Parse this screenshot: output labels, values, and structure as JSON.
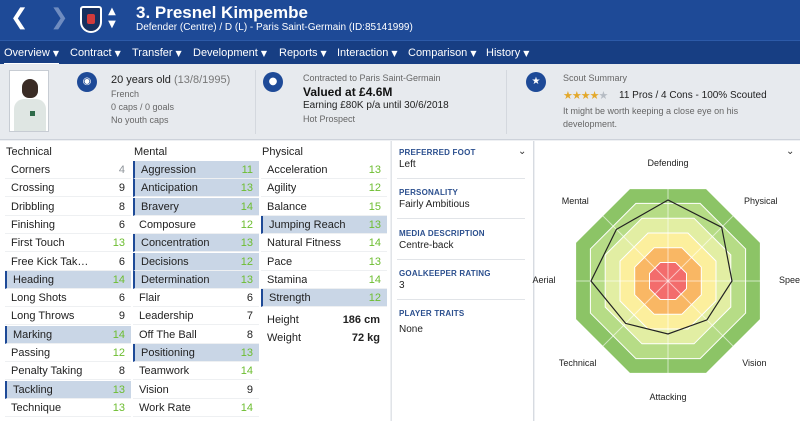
{
  "header": {
    "name": "3. Presnel Kimpembe",
    "subtitle": "Defender (Centre) / D (L) - Paris Saint-Germain (ID:85141999)"
  },
  "menu": [
    "Overview",
    "Contract",
    "Transfer",
    "Development",
    "Reports",
    "Interaction",
    "Comparison",
    "History"
  ],
  "personal": {
    "age": "20 years old",
    "dob": "(13/8/1995)",
    "nationality": "French",
    "caps": "0 caps / 0 goals",
    "youth_caps": "No youth caps"
  },
  "contract": {
    "club_line": "Contracted to Paris Saint-Germain",
    "value": "Valued at £4.6M",
    "earning": "Earning £80K p/a until 30/6/2018",
    "status": "Hot Prospect"
  },
  "scout": {
    "title": "Scout Summary",
    "rating_stars": 3.5,
    "stars_max": 5,
    "summary": "11 Pros / 4 Cons - 100% Scouted",
    "note_line1": "It might be worth keeping a close eye on his",
    "note_line2": "development."
  },
  "technical": {
    "title": "Technical",
    "rows": [
      {
        "label": "Corners",
        "value": "4"
      },
      {
        "label": "Crossing",
        "value": "9"
      },
      {
        "label": "Dribbling",
        "value": "8"
      },
      {
        "label": "Finishing",
        "value": "6"
      },
      {
        "label": "First Touch",
        "value": "13"
      },
      {
        "label": "Free Kick Tak…",
        "value": "6"
      },
      {
        "label": "Heading",
        "value": "14"
      },
      {
        "label": "Long Shots",
        "value": "6"
      },
      {
        "label": "Long Throws",
        "value": "9"
      },
      {
        "label": "Marking",
        "value": "14"
      },
      {
        "label": "Passing",
        "value": "12"
      },
      {
        "label": "Penalty Taking",
        "value": "8"
      },
      {
        "label": "Tackling",
        "value": "13"
      },
      {
        "label": "Technique",
        "value": "13"
      }
    ]
  },
  "mental": {
    "title": "Mental",
    "rows": [
      {
        "label": "Aggression",
        "value": "11"
      },
      {
        "label": "Anticipation",
        "value": "13"
      },
      {
        "label": "Bravery",
        "value": "14"
      },
      {
        "label": "Composure",
        "value": "12"
      },
      {
        "label": "Concentration",
        "value": "13"
      },
      {
        "label": "Decisions",
        "value": "12"
      },
      {
        "label": "Determination",
        "value": "13"
      },
      {
        "label": "Flair",
        "value": "6"
      },
      {
        "label": "Leadership",
        "value": "7"
      },
      {
        "label": "Off The Ball",
        "value": "8"
      },
      {
        "label": "Positioning",
        "value": "13"
      },
      {
        "label": "Teamwork",
        "value": "14"
      },
      {
        "label": "Vision",
        "value": "9"
      },
      {
        "label": "Work Rate",
        "value": "14"
      }
    ]
  },
  "physical": {
    "title": "Physical",
    "rows": [
      {
        "label": "Acceleration",
        "value": "13"
      },
      {
        "label": "Agility",
        "value": "12"
      },
      {
        "label": "Balance",
        "value": "15"
      },
      {
        "label": "Jumping Reach",
        "value": "13"
      },
      {
        "label": "Natural Fitness",
        "value": "14"
      },
      {
        "label": "Pace",
        "value": "13"
      },
      {
        "label": "Stamina",
        "value": "14"
      },
      {
        "label": "Strength",
        "value": "12"
      }
    ],
    "height_label": "Height",
    "height_value": "186 cm",
    "weight_label": "Weight",
    "weight_value": "72 kg"
  },
  "details": {
    "preferred_foot_label": "PREFERRED FOOT",
    "preferred_foot": "Left",
    "personality_label": "PERSONALITY",
    "personality": "Fairly Ambitious",
    "media_label": "MEDIA DESCRIPTION",
    "media": "Centre-back",
    "gk_label": "GOALKEEPER RATING",
    "gk": "3",
    "traits_label": "PLAYER TRAITS",
    "traits": "None"
  },
  "radar": {
    "labels": [
      "Defending",
      "Physical",
      "Speed",
      "Vision",
      "Attacking",
      "Technical",
      "Aerial",
      "Mental"
    ],
    "levels": [
      0.81,
      0.76,
      0.64,
      0.55,
      0.53,
      0.6,
      0.77,
      0.73
    ],
    "band_colors": [
      "#8cc466",
      "#b6dc86",
      "#e2eea3",
      "#fcef9d",
      "#f9b764",
      "#f36c6c"
    ]
  },
  "colors": {
    "title_bar": "#1e4a97",
    "menu_bar": "#173e83",
    "value_green": "#6cbd2f",
    "value_black": "#222222",
    "value_grey": "#8d9399",
    "highlight_row": "#c9d6e6"
  }
}
